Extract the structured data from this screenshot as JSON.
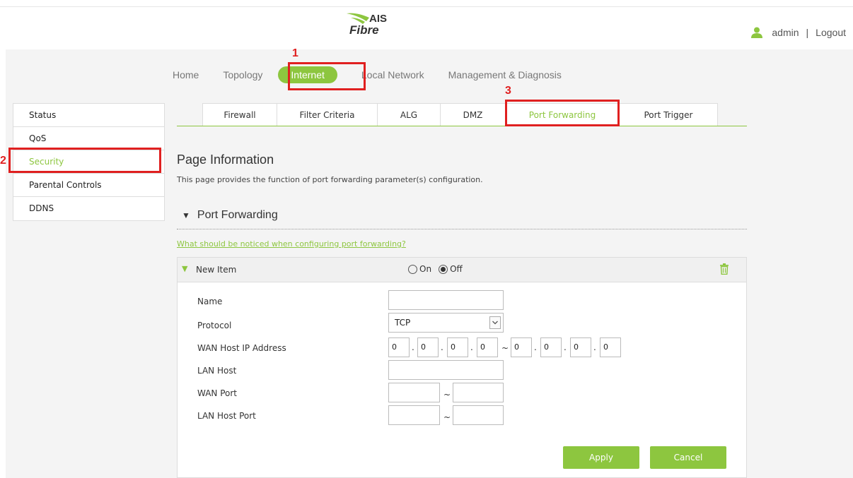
{
  "header": {
    "logo_top": "AIS",
    "logo_bottom": "Fibre",
    "user_name": "admin",
    "separator": "|",
    "logout_label": "Logout"
  },
  "top_nav": {
    "items": [
      "Home",
      "Topology",
      "Internet",
      "Local Network",
      "Management & Diagnosis"
    ],
    "active": "Internet"
  },
  "sidebar": {
    "items": [
      "Status",
      "QoS",
      "Security",
      "Parental Controls",
      "DDNS"
    ],
    "active": "Security"
  },
  "sub_tabs": {
    "items": [
      "Firewall",
      "Filter Criteria",
      "ALG",
      "DMZ",
      "Port Forwarding",
      "Port Trigger"
    ],
    "active": "Port Forwarding"
  },
  "annotations": [
    "1",
    "2",
    "3"
  ],
  "page": {
    "title": "Page Information",
    "description": "This page provides the function of port forwarding parameter(s) configuration.",
    "section_title": "Port Forwarding",
    "help_link": "What should be noticed when configuring port forwarding?"
  },
  "item": {
    "title": "New Item",
    "radio_on_label": "On",
    "radio_off_label": "Off",
    "selected": "Off"
  },
  "form": {
    "name_label": "Name",
    "name_value": "",
    "protocol_label": "Protocol",
    "protocol_value": "TCP",
    "wan_ip_label": "WAN Host IP Address",
    "wan_ip_start": [
      "0",
      "0",
      "0",
      "0"
    ],
    "wan_ip_end": [
      "0",
      "0",
      "0",
      "0"
    ],
    "ip_separator": ".",
    "range_separator": "~",
    "lan_host_label": "LAN Host",
    "lan_host_value": "",
    "wan_port_label": "WAN Port",
    "wan_port_start": "",
    "wan_port_end": "",
    "lan_port_label": "LAN Host Port",
    "lan_port_start": "",
    "lan_port_end": ""
  },
  "buttons": {
    "apply": "Apply",
    "cancel": "Cancel"
  },
  "colors": {
    "accent": "#8dc63f",
    "highlight": "#e02020"
  }
}
